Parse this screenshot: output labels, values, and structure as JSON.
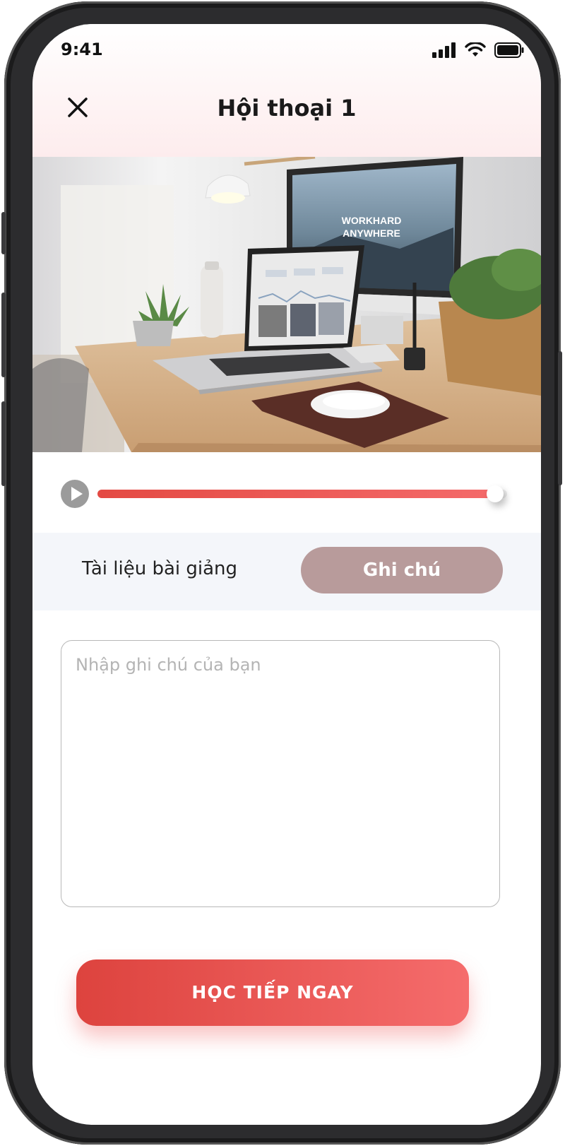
{
  "status_bar": {
    "time": "9:41"
  },
  "header": {
    "title": "Hội thoại 1"
  },
  "photo": {
    "monitor_text_line1": "WORKHARD",
    "monitor_text_line2": "ANYWHERE"
  },
  "player": {
    "progress": 0.97
  },
  "tabs": [
    {
      "label": "Tài liệu bài giảng"
    },
    {
      "label": "Ghi chú"
    }
  ],
  "note": {
    "placeholder": "Nhập ghi chú của bạn",
    "value": ""
  },
  "cta": {
    "label": "HỌC TIẾP NGAY"
  },
  "colors": {
    "accent": "#e74c47",
    "tab_active": "#b89b9b",
    "tabs_bg": "#f4f6fa"
  }
}
